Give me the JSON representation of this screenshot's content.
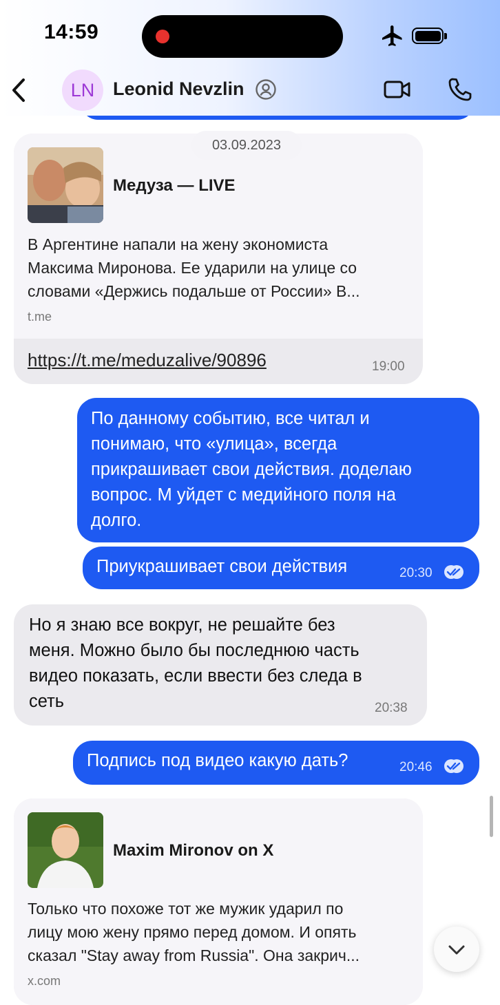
{
  "status_bar": {
    "time": "14:59"
  },
  "header": {
    "avatar_initials": "LN",
    "contact_name": "Leonid Nevzlin"
  },
  "date_separator": "03.09.2023",
  "messages": [
    {
      "direction": "incoming",
      "preview_site": "Медуза — LIVE",
      "preview_text_lines": [
        "В Аргентине напали на жену экономиста",
        "Максима Миронова. Ее ударили на улице со",
        "словами «Держись подальше от России» В..."
      ],
      "preview_domain": "t.me",
      "link": "https://t.me/meduzalive/90896",
      "time": "19:00"
    },
    {
      "direction": "outgoing",
      "text_lines": [
        "По данному событию, все читал и",
        "понимаю, что «улица», всегда",
        "прикрашивает свои действия. доделаю",
        "вопрос. М уйдет с медийного поля на",
        "долго."
      ]
    },
    {
      "direction": "outgoing",
      "text": "Приукрашивает свои действия",
      "time": "20:30"
    },
    {
      "direction": "incoming",
      "text_lines": [
        "Но я знаю все вокруг, не решайте без",
        "меня. Можно было бы последнюю часть",
        "видео показать, если ввести без следа в",
        "сеть"
      ],
      "time": "20:38"
    },
    {
      "direction": "outgoing",
      "text": "Подпись под видео какую дать?",
      "time": "20:46"
    },
    {
      "direction": "incoming",
      "preview_site": "Maxim Mironov on X",
      "preview_text_lines": [
        "Только что похоже тот же мужик ударил по",
        "лицу мою жену прямо перед домом. И опять",
        "сказал \"Stay away from Russia\". Она закрич..."
      ],
      "preview_domain": "x.com"
    }
  ],
  "colors": {
    "outgoing_bubble": "#1e5af2",
    "incoming_bubble": "#ebeaee",
    "avatar_bg": "#f1dbfd",
    "avatar_text": "#9d39d6"
  },
  "icons": [
    "back-chevron-icon",
    "contact-info-icon",
    "video-call-icon",
    "phone-icon",
    "airplane-mode-icon",
    "battery-icon",
    "read-receipt-icon",
    "chevron-down-icon"
  ]
}
